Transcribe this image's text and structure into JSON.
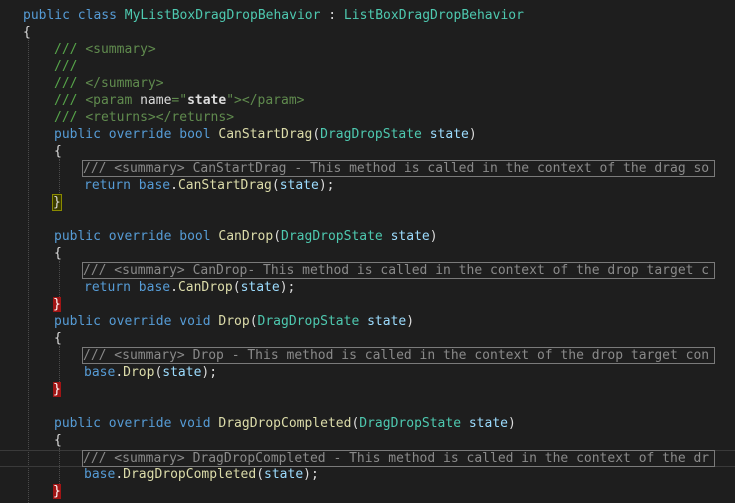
{
  "code": {
    "class_decl": {
      "kw1": "public",
      "kw2": "class",
      "name": "MyListBoxDragDropBehavior",
      "sep": " : ",
      "base": "ListBoxDragDropBehavior"
    },
    "open_brace": "{",
    "doc": {
      "l1_slashes": "/// ",
      "l1_tag": "<summary>",
      "l2": "///",
      "l3_slashes": "/// ",
      "l3_tag": "</summary>",
      "l4_slashes": "/// ",
      "l4_tag_open": "<param ",
      "l4_attr": "name",
      "l4_eq": "=\"",
      "l4_val": "state",
      "l4_quote": "\"",
      "l4_tag_close": "></param>",
      "l5_slashes": "/// ",
      "l5_tag": "<returns></returns>"
    },
    "m1": {
      "kw_public": "public",
      "kw_override": "override",
      "kw_bool": "bool",
      "name": "CanStartDrag",
      "type": "DragDropState",
      "param": "state",
      "collapsed": "/// <summary> CanStartDrag - This method is called in the context of the drag so ...",
      "ret": "return",
      "base": "base",
      "call": "CanStartDrag",
      "arg": "state"
    },
    "m2": {
      "kw_public": "public",
      "kw_override": "override",
      "kw_bool": "bool",
      "name": "CanDrop",
      "type": "DragDropState",
      "param": "state",
      "collapsed": "/// <summary> CanDrop- This method is called in the context of the drop target c ...",
      "ret": "return",
      "base": "base",
      "call": "CanDrop",
      "arg": "state"
    },
    "m3": {
      "kw_public": "public",
      "kw_override": "override",
      "kw_void": "void",
      "name": "Drop",
      "type": "DragDropState",
      "param": "state",
      "collapsed": "/// <summary> Drop - This method is called in the context of the drop target con ...",
      "base": "base",
      "call": "Drop",
      "arg": "state"
    },
    "m4": {
      "kw_public": "public",
      "kw_override": "override",
      "kw_void": "void",
      "name": "DragDropCompleted",
      "type": "DragDropState",
      "param": "state",
      "collapsed": "/// <summary> DragDropCompleted - This method is called in the context of the dr ...",
      "base": "base",
      "call": "DragDropCompleted",
      "arg": "state"
    },
    "brace_open": "{",
    "brace_close": "}"
  },
  "colors": {
    "background": "#1e1e1e",
    "keyword": "#569cd6",
    "type": "#4ec9b0",
    "method": "#dcdcaa",
    "parameter": "#9cdcfe",
    "comment": "#57a64a",
    "highlight_brace_red": "#a01515"
  }
}
